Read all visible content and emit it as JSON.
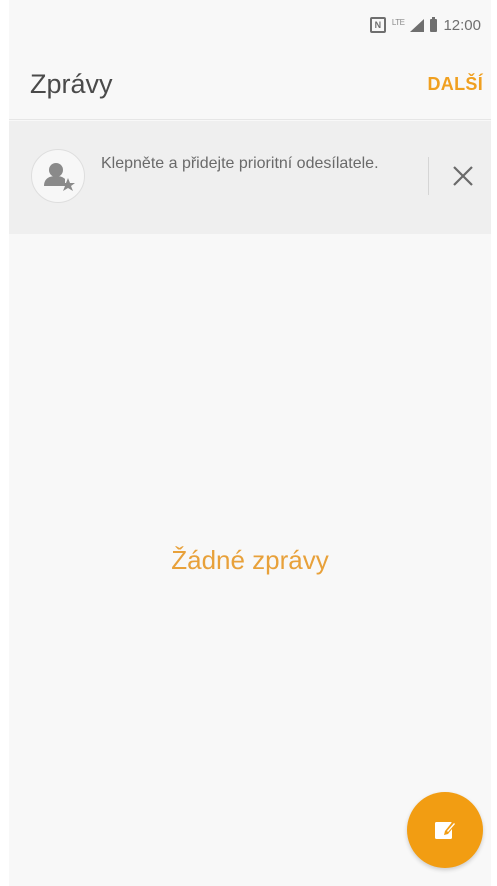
{
  "status_bar": {
    "nfc_label": "N",
    "network_label": "LTE",
    "time": "12:00"
  },
  "app_bar": {
    "title": "Zprávy",
    "more_label": "DALŠÍ"
  },
  "banner": {
    "text": "Klepněte a přidejte prioritní odesílatele.",
    "icon": "priority-sender-add-icon"
  },
  "empty_state": {
    "text": "Žádné zprávy"
  },
  "fab": {
    "icon": "compose-icon"
  },
  "colors": {
    "accent": "#f29d12",
    "accent_text": "#f0a020",
    "background": "#f8f8f8",
    "banner_bg": "#efefef"
  }
}
